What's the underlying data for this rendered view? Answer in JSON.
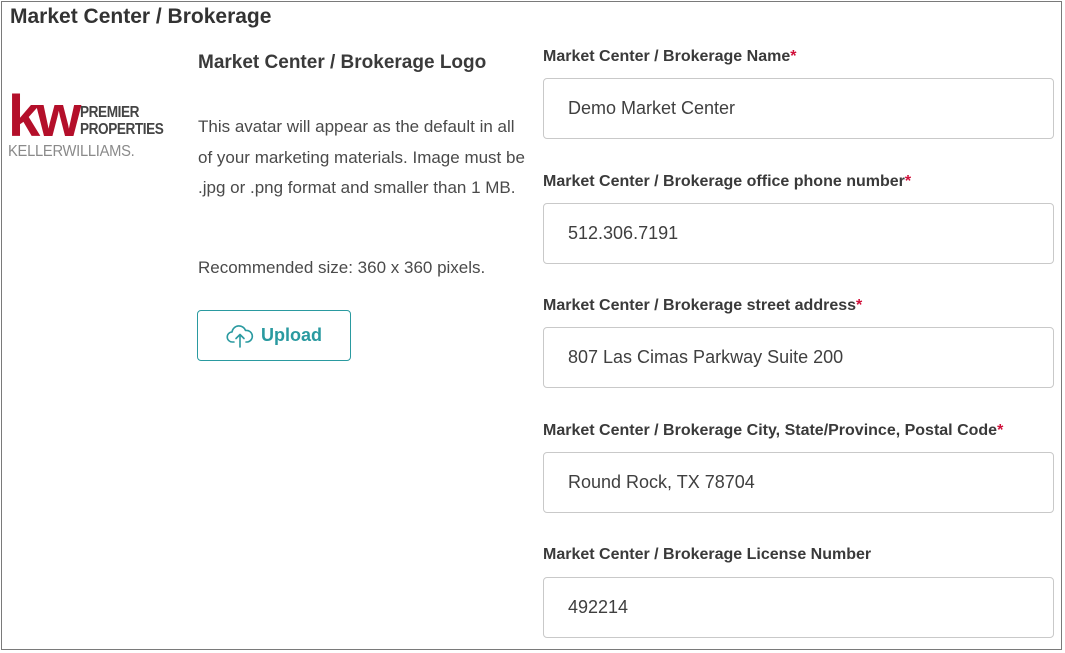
{
  "section": {
    "title": "Market Center / Brokerage"
  },
  "logo": {
    "mark": "kw",
    "line1": "PREMIER",
    "line2": "PROPERTIES",
    "line3": "KELLERWILLIAMS.",
    "brand_red": "#b40f2a"
  },
  "logo_panel": {
    "heading": "Market Center / Brokerage Logo",
    "description": "This avatar will appear as the default in all of your marketing materials. Image must be .jpg or .png format and smaller than 1 MB.",
    "recommended": "Recommended size: 360 x 360 pixels.",
    "upload_label": "Upload",
    "upload_icon": "cloud-upload-icon",
    "accent": "#2a9aa0"
  },
  "fields": [
    {
      "label": "Market Center / Brokerage Name",
      "required": "*",
      "value": "Demo Market Center"
    },
    {
      "label": "Market Center / Brokerage office phone number",
      "required": "*",
      "value": "512.306.7191"
    },
    {
      "label": "Market Center / Brokerage street address",
      "required": "*",
      "value": "807 Las Cimas Parkway Suite 200"
    },
    {
      "label": "Market Center / Brokerage City, State/Province, Postal Code",
      "required": "*",
      "value": "Round Rock, TX 78704"
    },
    {
      "label": "Market Center / Brokerage License Number",
      "value": "492214"
    }
  ]
}
